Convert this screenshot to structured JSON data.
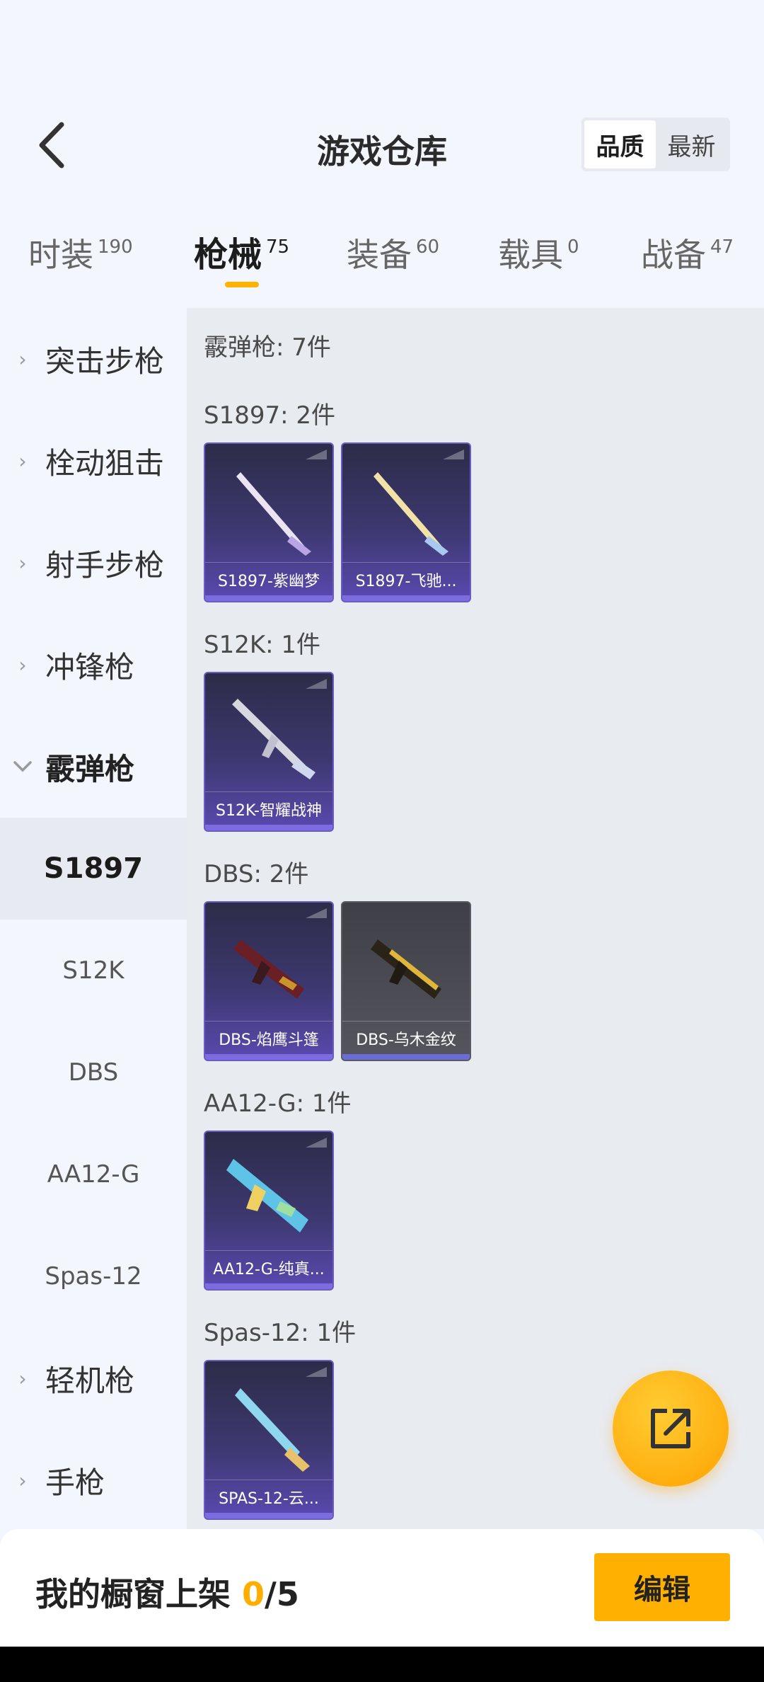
{
  "header": {
    "title": "游戏仓库",
    "sort_options": [
      "品质",
      "最新"
    ]
  },
  "tabs": [
    {
      "label": "时装",
      "count": "190"
    },
    {
      "label": "枪械",
      "count": "75"
    },
    {
      "label": "装备",
      "count": "60"
    },
    {
      "label": "载具",
      "count": "0"
    },
    {
      "label": "战备",
      "count": "47"
    }
  ],
  "sidebar": {
    "categories": [
      "突击步枪",
      "栓动狙击",
      "射手步枪",
      "冲锋枪",
      "霰弹枪",
      "轻机枪",
      "手枪"
    ],
    "subitems": [
      "S1897",
      "S12K",
      "DBS",
      "AA12-G",
      "Spas-12"
    ]
  },
  "main": {
    "category_heading": "霰弹枪: 7件",
    "groups": [
      {
        "heading": "S1897: 2件",
        "items": [
          "S1897-紫幽梦",
          "S1897-飞驰..."
        ]
      },
      {
        "heading": "S12K: 1件",
        "items": [
          "S12K-智耀战神"
        ]
      },
      {
        "heading": "DBS: 2件",
        "items": [
          "DBS-焰鹰斗篷",
          "DBS-乌木金纹"
        ]
      },
      {
        "heading": "AA12-G: 1件",
        "items": [
          "AA12-G-纯真..."
        ]
      },
      {
        "heading": "Spas-12: 1件",
        "items": [
          "SPAS-12-云..."
        ]
      }
    ]
  },
  "bottom": {
    "prefix": "我的橱窗上架 ",
    "current": "0",
    "suffix": "/5",
    "edit_label": "编辑"
  },
  "icons": {
    "back": "chevron-left-icon",
    "share": "share-external-icon"
  },
  "colors": {
    "accent": "#ffb000",
    "card_purple": "#5a49b0"
  }
}
